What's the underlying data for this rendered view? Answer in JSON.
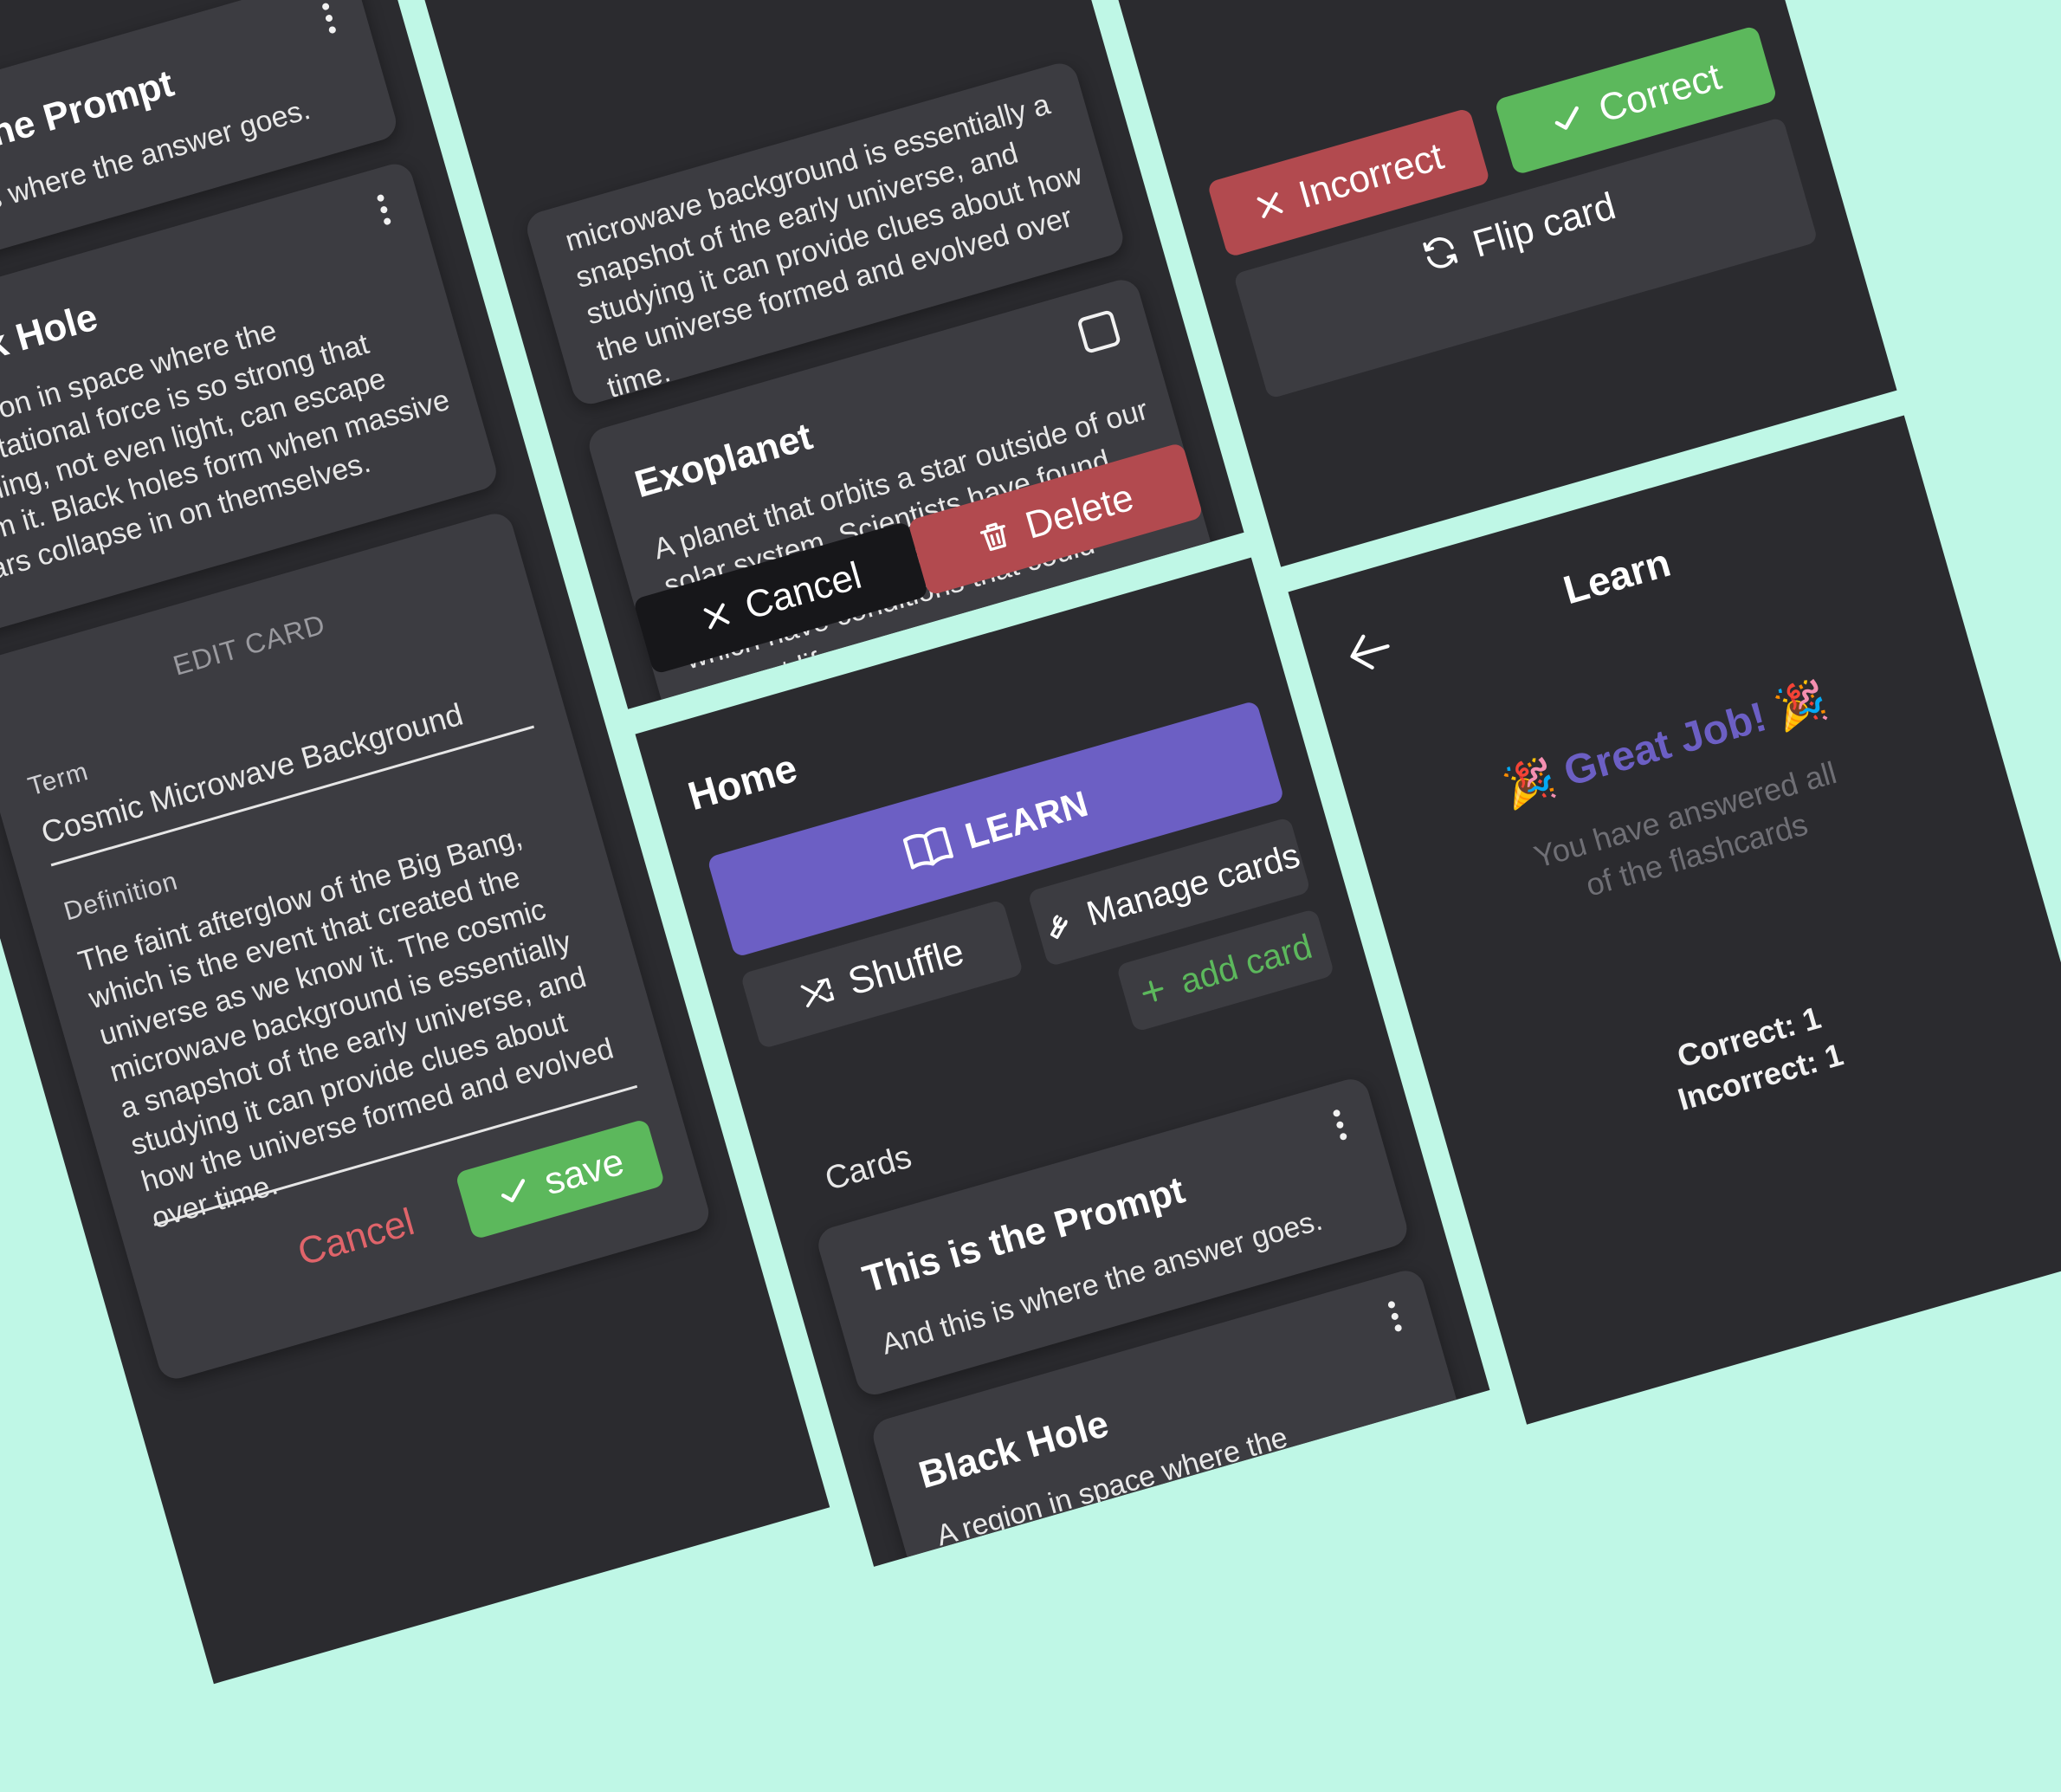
{
  "colors": {
    "background": "#bff7e6",
    "panel": "#2b2b2f",
    "card": "#3c3c41",
    "learn": "#6c5fc4",
    "correct": "#5cb85c",
    "incorrect": "#b24a4f",
    "delete": "#b24a4f",
    "cancel": "#17171a",
    "add_card": "#5cb85c"
  },
  "left": {
    "prompt_card": {
      "title": "This is the Prompt",
      "text": "And this is where the answer goes."
    },
    "blackhole_card": {
      "title": "Black Hole",
      "text": "A region in space where the gravitational force is so strong that nothing, not even light, can escape from it. Black holes form when massive stars collapse in on themselves."
    },
    "edit_card": {
      "header": "EDIT CARD",
      "term_label": "Term",
      "term_value": "Cosmic Microwave Background",
      "definition_label": "Definition",
      "definition_value": "The faint afterglow of the Big Bang, which is the event that created the universe as we know it. The cosmic microwave background is essentially a snapshot of the early universe, and studying it can provide clues about how the universe formed and evolved over time.",
      "cancel_label": "Cancel",
      "save_label": "save"
    }
  },
  "middle_top": {
    "cmb_snippet": "microwave background is essentially a snapshot of the early universe, and studying it can provide clues about how the universe formed and evolved over time.",
    "exoplanet_card": {
      "title": "Exoplanet",
      "text": "A planet that orbits a star outside of our solar system. Scientists have found thousands of exoplanets, many of which have conditions that could support life."
    },
    "cancel_label": "Cancel",
    "delete_label": "Delete"
  },
  "home": {
    "title": "Home",
    "learn_label": "LEARN",
    "shuffle_label": "Shuffle",
    "manage_label": "Manage cards",
    "add_label": "add card",
    "cards_heading": "Cards",
    "cards": [
      {
        "title": "This is the Prompt",
        "text": "And this is where the answer goes."
      },
      {
        "title": "Black Hole",
        "text": "A region in space where the gravitational force is so strong that"
      }
    ]
  },
  "right_top": {
    "incorrect_label": "Incorrect",
    "correct_label": "Correct",
    "flip_label": "Flip card"
  },
  "learn_screen": {
    "title": "Learn",
    "great_job": "🎉 Great Job! 🎉",
    "message": "You have answered all of the flashcards",
    "correct_stat": "Correct: 1",
    "incorrect_stat": "Incorrect: 1"
  }
}
